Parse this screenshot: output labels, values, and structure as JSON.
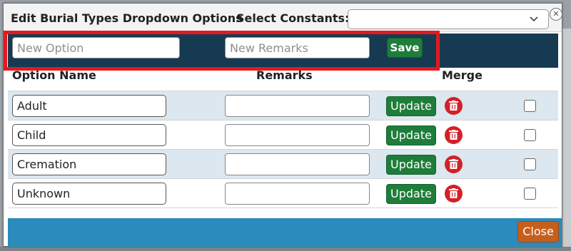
{
  "dialog": {
    "title": "Edit Burial Types Dropdown Options",
    "constants_label": "Select Constants:",
    "constants_value": "",
    "close_icon": "close-circle-icon"
  },
  "new_entry": {
    "option_placeholder": "New Option",
    "remarks_placeholder": "New Remarks",
    "save_label": "Save"
  },
  "table": {
    "headers": [
      "Option Name",
      "Remarks",
      "Merge"
    ],
    "rows": [
      {
        "option": "Adult",
        "remarks": "",
        "update_label": "Update"
      },
      {
        "option": "Child",
        "remarks": "",
        "update_label": "Update"
      },
      {
        "option": "Cremation",
        "remarks": "",
        "update_label": "Update"
      },
      {
        "option": "Unknown",
        "remarks": "",
        "update_label": "Update"
      }
    ]
  },
  "footer": {
    "close_label": "Close"
  },
  "colors": {
    "header_band": "#163a52",
    "highlight": "#e3191f",
    "button_green": "#1e7d3a",
    "delete_red": "#d32027",
    "footer_blue": "#2a8bbc",
    "close_orange": "#c75f1c",
    "row_alt": "#dce7ef"
  }
}
